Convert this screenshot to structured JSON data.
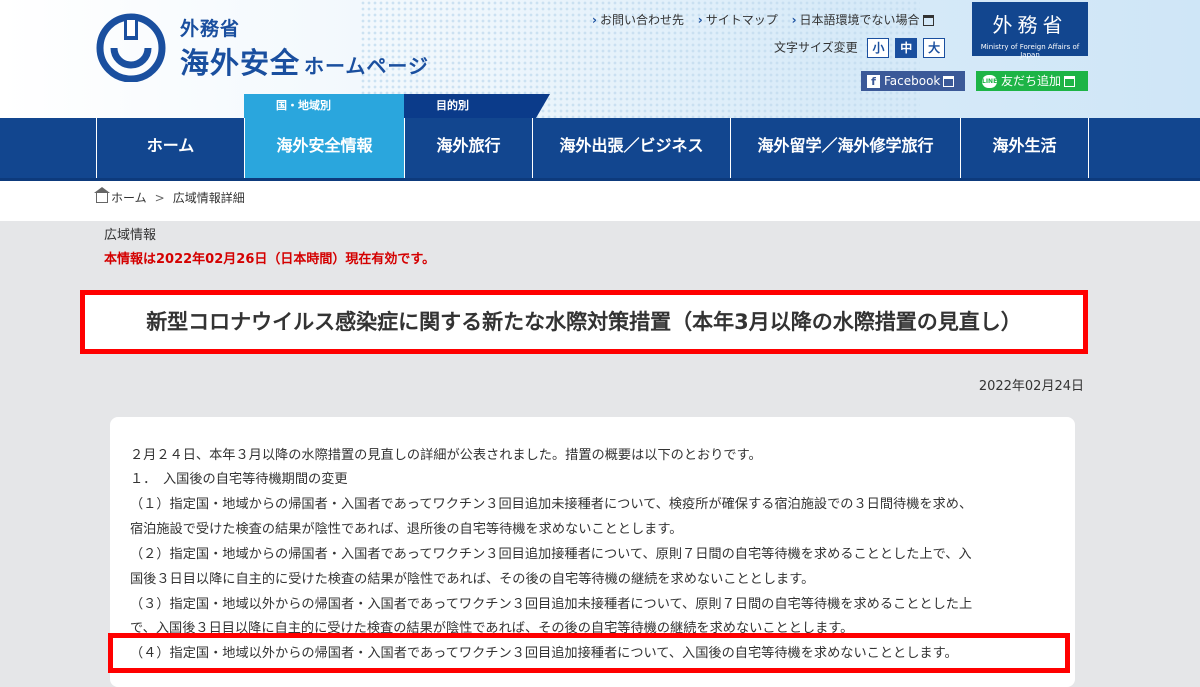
{
  "header": {
    "logo_small": "外務省",
    "logo_big": "海外安全",
    "logo_big_suffix": "ホームページ",
    "top_links": [
      "お問い合わせ先",
      "サイトマップ",
      "日本語環境でない場合"
    ],
    "font_size_label": "文字サイズ変更",
    "font_sizes": [
      "小",
      "中",
      "大"
    ],
    "mofa_jp": "外務省",
    "mofa_en": "Ministry of Foreign Affairs of Japan",
    "facebook_label": "Facebook",
    "line_label": "友だち追加",
    "line_icon_text": "LINE",
    "subtabs": [
      "国・地域別",
      "目的別"
    ]
  },
  "nav": {
    "items": [
      "ホーム",
      "海外安全情報",
      "海外旅行",
      "海外出張／ビジネス",
      "海外留学／海外修学旅行",
      "海外生活"
    ]
  },
  "breadcrumb": {
    "home": "ホーム",
    "separator": ">",
    "current": "広域情報詳細"
  },
  "content": {
    "kind": "広域情報",
    "valid_notice": "本情報は2022年02月26日（日本時間）現在有効です。",
    "title": "新型コロナウイルス感染症に関する新たな水際対策措置（本年3月以降の水際措置の見直し）",
    "date": "2022年02月24日",
    "paragraphs": [
      "２月２４日、本年３月以降の水際措置の見直しの詳細が公表されました。措置の概要は以下のとおりです。",
      "１．　入国後の自宅等待機期間の変更",
      "（１）指定国・地域からの帰国者・入国者であってワクチン３回目追加未接種者について、検疫所が確保する宿泊施設での３日間待機を求め、",
      "宿泊施設で受けた検査の結果が陰性であれば、退所後の自宅等待機を求めないこととします。",
      "（２）指定国・地域からの帰国者・入国者であってワクチン３回目追加接種者について、原則７日間の自宅等待機を求めることとした上で、入",
      "国後３日目以降に自主的に受けた検査の結果が陰性であれば、その後の自宅等待機の継続を求めないこととします。",
      "（３）指定国・地域以外からの帰国者・入国者であってワクチン３回目追加未接種者について、原則７日間の自宅等待機を求めることとした上",
      "で、入国後３日目以降に自主的に受けた検査の結果が陰性であれば、その後の自宅等待機の継続を求めないこととします。",
      "（４）指定国・地域以外からの帰国者・入国者であってワクチン３回目追加接種者について、入国後の自宅等待機を求めないこととします。"
    ]
  },
  "colors": {
    "brand_blue": "#12468f",
    "active_blue": "#2aa6dd",
    "highlight_red": "#ff0000",
    "notice_red": "#d40000"
  }
}
